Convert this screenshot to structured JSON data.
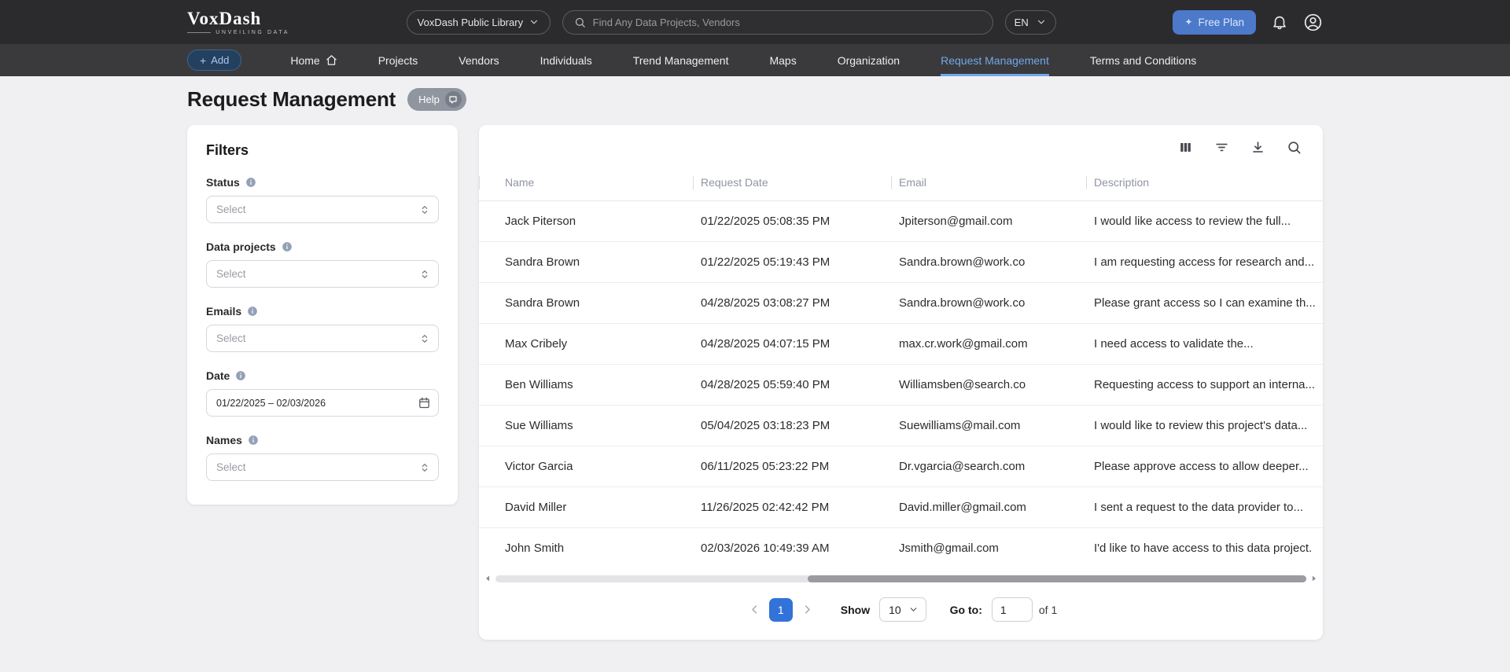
{
  "colors": {
    "topbar_bg": "#2b2b2d",
    "navbar_bg": "#3a3a3c",
    "accent_blue": "#3273d9",
    "active_tab_blue": "#72a7e9",
    "free_plan_bg": "#4c79ca",
    "help_btn_bg": "#8f96a0"
  },
  "topbar": {
    "brand": "VoxDash",
    "tagline": "UNVEILING DATA",
    "library_selector": "VoxDash Public Library",
    "search_placeholder": "Find Any Data Projects, Vendors",
    "language": "EN",
    "free_plan_label": "Free Plan",
    "icons": [
      "sparkle-icon",
      "search-icon",
      "chevron-down-icon",
      "bell-icon",
      "avatar-icon"
    ]
  },
  "navbar": {
    "add_label": "Add",
    "items": [
      "Home",
      "Projects",
      "Vendors",
      "Individuals",
      "Trend Management",
      "Maps",
      "Organization",
      "Request Management",
      "Terms and Conditions"
    ],
    "active_item": "Request Management",
    "icons": [
      "plus-icon",
      "home-icon"
    ]
  },
  "page": {
    "title": "Request Management",
    "help_label": "Help"
  },
  "filters": {
    "title": "Filters",
    "fields": [
      {
        "label": "Status",
        "placeholder": "Select"
      },
      {
        "label": "Data projects",
        "placeholder": "Select"
      },
      {
        "label": "Emails",
        "placeholder": "Select"
      },
      {
        "label": "Date",
        "value": "01/22/2025 – 02/03/2026"
      },
      {
        "label": "Names",
        "placeholder": "Select"
      }
    ],
    "icons": [
      "info-icon",
      "unfold-icon",
      "calendar-icon"
    ]
  },
  "table": {
    "toolbar_icons": [
      "columns-icon",
      "filter-icon",
      "download-icon",
      "search-icon"
    ],
    "columns": [
      "Name",
      "Request Date",
      "Email",
      "Description"
    ],
    "rows": [
      {
        "name": "Jack Piterson",
        "request_date": "01/22/2025 05:08:35 PM",
        "email": "Jpiterson@gmail.com",
        "description": "I would like access to review the full..."
      },
      {
        "name": "Sandra Brown",
        "request_date": "01/22/2025 05:19:43 PM",
        "email": "Sandra.brown@work.co",
        "description": "I am requesting access for research and..."
      },
      {
        "name": "Sandra Brown",
        "request_date": "04/28/2025 03:08:27 PM",
        "email": "Sandra.brown@work.co",
        "description": "Please grant access so I can examine th..."
      },
      {
        "name": "Max Cribely",
        "request_date": "04/28/2025 04:07:15 PM",
        "email": "max.cr.work@gmail.com",
        "description": "I need access to validate the..."
      },
      {
        "name": "Ben Williams",
        "request_date": "04/28/2025 05:59:40 PM",
        "email": "Williamsben@search.co",
        "description": "Requesting access to support an interna..."
      },
      {
        "name": "Sue Williams",
        "request_date": "05/04/2025 03:18:23 PM",
        "email": "Suewilliams@mail.com",
        "description": "I would like to review this project's data..."
      },
      {
        "name": "Victor Garcia",
        "request_date": "06/11/2025 05:23:22 PM",
        "email": "Dr.vgarcia@search.com",
        "description": "Please approve access to allow deeper..."
      },
      {
        "name": "David Miller",
        "request_date": "11/26/2025 02:42:42 PM",
        "email": "David.miller@gmail.com",
        "description": "I sent a request to the data provider to..."
      },
      {
        "name": "John Smith",
        "request_date": "02/03/2026 10:49:39 AM",
        "email": "Jsmith@gmail.com",
        "description": "I'd like to have access to this data project."
      }
    ]
  },
  "pagination": {
    "current_page": "1",
    "show_label": "Show",
    "page_size": "10",
    "goto_label": "Go to:",
    "goto_value": "1",
    "of_label": "of 1"
  }
}
